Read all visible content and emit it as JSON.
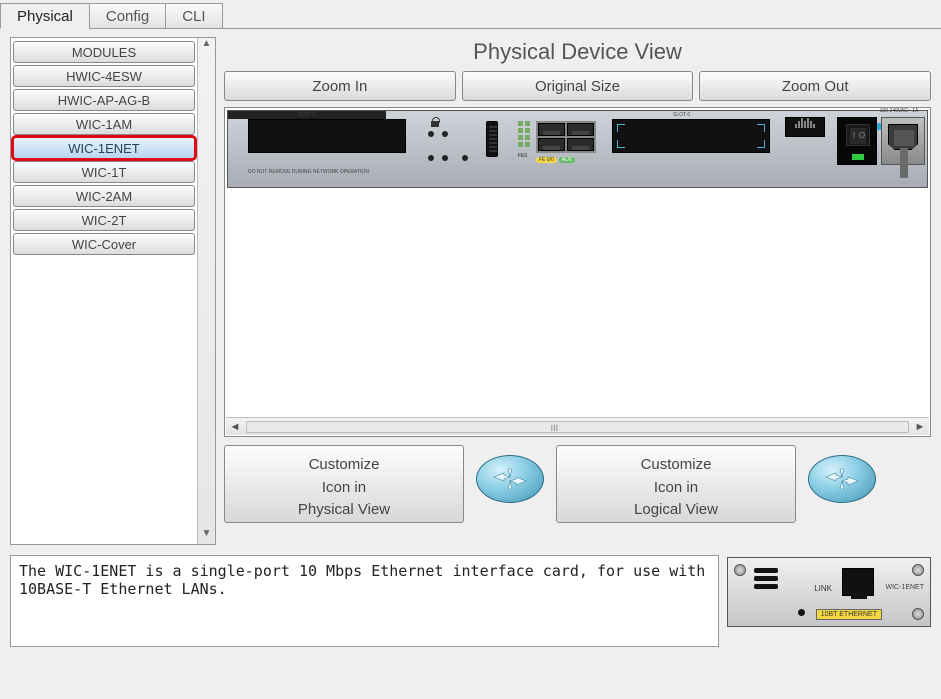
{
  "tabs": {
    "physical": "Physical",
    "config": "Config",
    "cli": "CLI",
    "active": "physical"
  },
  "modules": {
    "header": "MODULES",
    "items": [
      "HWIC-4ESW",
      "HWIC-AP-AG-B",
      "WIC-1AM",
      "WIC-1ENET",
      "WIC-1T",
      "WIC-2AM",
      "WIC-2T",
      "WIC-Cover"
    ],
    "selected": "WIC-1ENET"
  },
  "view": {
    "title": "Physical Device View",
    "zoom_in": "Zoom In",
    "original": "Original Size",
    "zoom_out": "Zoom Out"
  },
  "chassis": {
    "slot1_label": "SLOT 1",
    "slot0_label": "SLOT 0",
    "psu_label": "100-240VAC~ 1A",
    "bottom_note": "DO NOT REMOVE DURING NETWORK OPERATION",
    "eth_label": "FE0",
    "badge1": "FE 0/0",
    "badge2": "AUX",
    "power_i": "I",
    "power_o": "O"
  },
  "customize": {
    "physical_l1": "Customize",
    "physical_l2": "Icon in",
    "physical_l3": "Physical View",
    "logical_l1": "Customize",
    "logical_l2": "Icon in",
    "logical_l3": "Logical View"
  },
  "description": "The WIC-1ENET is a single-port 10 Mbps Ethernet interface card, for use with 10BASE-T Ethernet LANs.",
  "preview": {
    "link": "LINK",
    "tag": "10BT ETHERNET",
    "wic": "WIC-1ENET"
  },
  "hscroll_grip": "III"
}
